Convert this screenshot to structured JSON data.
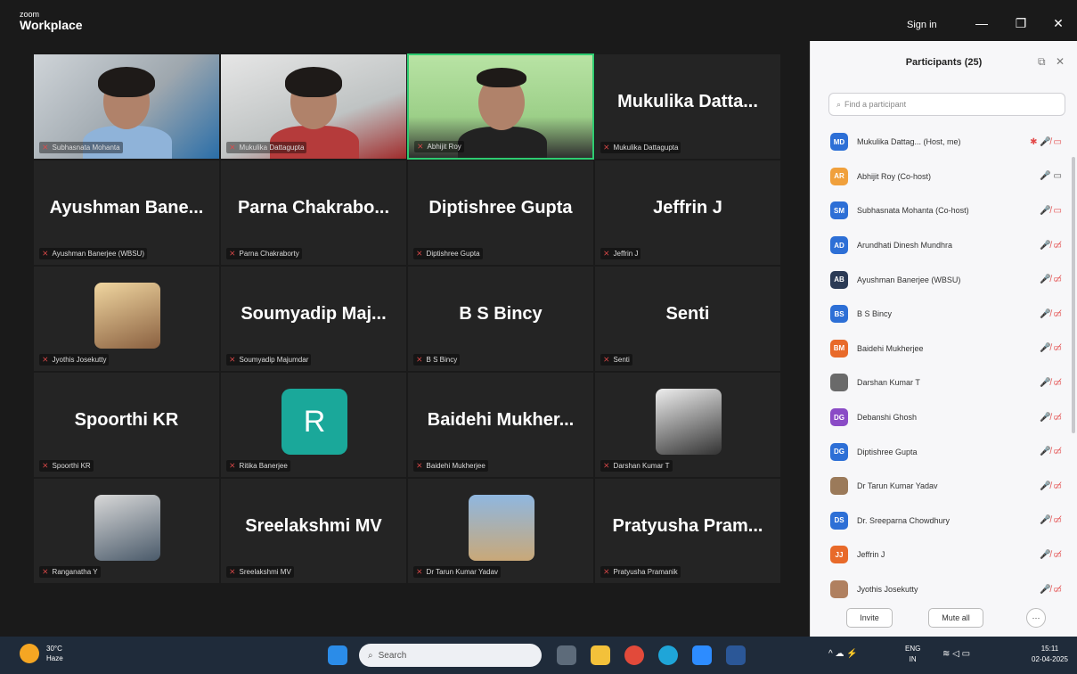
{
  "titlebar": {
    "logo_small": "zoom",
    "logo_big": "Workplace",
    "signin": "Sign in",
    "minimize": "—",
    "restore": "❐",
    "close": "✕"
  },
  "tiles": [
    {
      "big": "",
      "label": "Subhasnata Mohanta",
      "video": "cam1"
    },
    {
      "big": "",
      "label": "Mukulika Dattagupta",
      "video": "cam2"
    },
    {
      "big": "",
      "label": "Abhijit Roy",
      "video": "cam3"
    },
    {
      "big": "Mukulika Datta...",
      "label": "Mukulika Dattagupta"
    },
    {
      "big": "Ayushman Bane...",
      "label": "Ayushman Banerjee (WBSU)"
    },
    {
      "big": "Parna Chakrabo...",
      "label": "Parna Chakraborty"
    },
    {
      "big": "Diptishree Gupta",
      "label": "Diptishree Gupta"
    },
    {
      "big": "Jeffrin J",
      "label": "Jeffrin J"
    },
    {
      "big": "",
      "label": "Jyothis Josekutty",
      "pic": "jyothis"
    },
    {
      "big": "Soumyadip Maj...",
      "label": "Soumyadip Majumdar"
    },
    {
      "big": "B S Bincy",
      "label": "B S Bincy"
    },
    {
      "big": "Senti",
      "label": "Senti"
    },
    {
      "big": "Spoorthi KR",
      "label": "Spoorthi KR"
    },
    {
      "big": "",
      "label": "Ritika Banerjee",
      "letter": "R"
    },
    {
      "big": "Baidehi Mukher...",
      "label": "Baidehi Mukherjee"
    },
    {
      "big": "",
      "label": "Darshan Kumar T",
      "pic": "darshan"
    },
    {
      "big": "",
      "label": "Ranganatha Y",
      "pic": "ranganatha"
    },
    {
      "big": "Sreelakshmi MV",
      "label": "Sreelakshmi MV"
    },
    {
      "big": "",
      "label": "Dr Tarun Kumar Yadav",
      "pic": "tarun"
    },
    {
      "big": "Pratyusha Pram...",
      "label": "Pratyusha Pramanik"
    }
  ],
  "panel": {
    "title": "Participants (25)",
    "popout": "⧉",
    "close": "✕",
    "search_placeholder": "Find a participant",
    "participants": [
      {
        "initials": "MD",
        "color": "#2d6fd6",
        "name": "Mukulika Dattag... (Host, me)",
        "icons": "✱  🎤̸  ▭"
      },
      {
        "initials": "AR",
        "color": "#f0a03c",
        "name": "Abhijit Roy (Co-host)",
        "icons": "🎤  ▭",
        "live": true
      },
      {
        "initials": "SM",
        "color": "#2d6fd6",
        "name": "Subhasnata Mohanta (Co-host)",
        "icons": "🎤̸  ▭"
      },
      {
        "initials": "AD",
        "color": "#2d6fd6",
        "name": "Arundhati Dinesh Mundhra",
        "icons": "🎤̸  ▭̸"
      },
      {
        "initials": "AB",
        "color": "#2b3a55",
        "name": "Ayushman Banerjee (WBSU)",
        "icons": "🎤̸  ▭̸"
      },
      {
        "initials": "BS",
        "color": "#2d6fd6",
        "name": "B S Bincy",
        "icons": "🎤̸  ▭̸"
      },
      {
        "initials": "BM",
        "color": "#e86a2a",
        "name": "Baidehi Mukherjee",
        "icons": "🎤̸  ▭̸"
      },
      {
        "initials": "",
        "color": "#6a6a6a",
        "name": "Darshan Kumar T",
        "icons": "🎤̸  ▭̸"
      },
      {
        "initials": "DG",
        "color": "#8a4bc6",
        "name": "Debanshi Ghosh",
        "icons": "🎤̸  ▭̸"
      },
      {
        "initials": "DG",
        "color": "#2d6fd6",
        "name": "Diptishree Gupta",
        "icons": "🎤̸  ▭̸"
      },
      {
        "initials": "",
        "color": "#9b7a5a",
        "name": "Dr Tarun Kumar Yadav",
        "icons": "🎤̸  ▭̸"
      },
      {
        "initials": "DS",
        "color": "#2d6fd6",
        "name": "Dr. Sreeparna Chowdhury",
        "icons": "🎤̸  ▭̸"
      },
      {
        "initials": "JJ",
        "color": "#e86a2a",
        "name": "Jeffrin J",
        "icons": "🎤̸  ▭̸"
      },
      {
        "initials": "",
        "color": "#b08060",
        "name": "Jyothis Josekutty",
        "icons": "🎤̸  ▭̸"
      }
    ],
    "invite": "Invite",
    "mute_all": "Mute all",
    "more": "···"
  },
  "taskbar": {
    "temp": "30°C",
    "condition": "Haze",
    "search": "Search",
    "lang1": "ENG",
    "lang2": "IN",
    "time": "15:11",
    "date": "02-04-2025"
  }
}
